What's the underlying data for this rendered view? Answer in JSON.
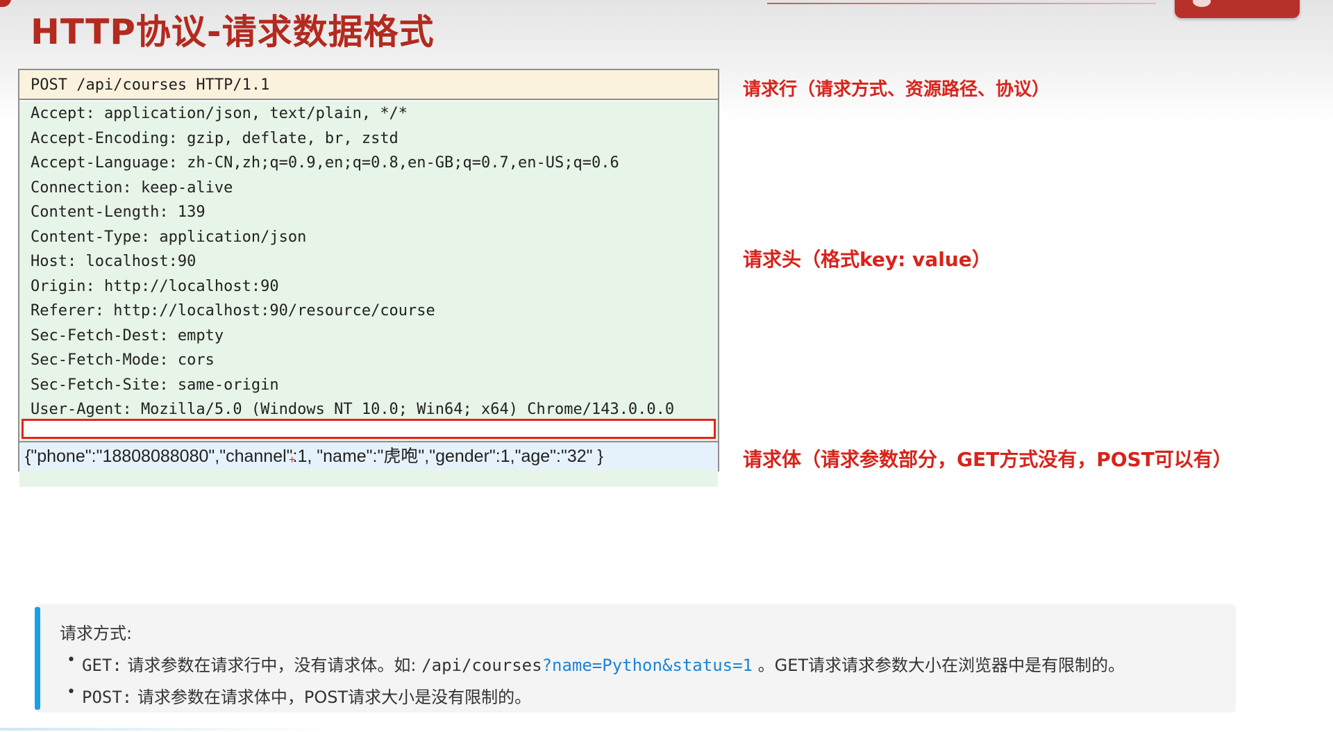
{
  "title": "HTTP协议-请求数据格式",
  "request": {
    "request_line": "POST /api/courses HTTP/1.1",
    "headers": [
      "Accept: application/json, text/plain, */*",
      "Accept-Encoding: gzip, deflate, br, zstd",
      "Accept-Language: zh-CN,zh;q=0.9,en;q=0.8,en-GB;q=0.7,en-US;q=0.6",
      "Connection: keep-alive",
      "Content-Length: 139",
      "Content-Type: application/json",
      "Host: localhost:90",
      "Origin: http://localhost:90",
      "Referer: http://localhost:90/resource/course",
      "Sec-Fetch-Dest: empty",
      "Sec-Fetch-Mode: cors",
      "Sec-Fetch-Site: same-origin",
      "User-Agent: Mozilla/5.0 (Windows NT 10.0; Win64; x64) Chrome/143.0.0.0"
    ],
    "body": "{\"phone\":\"18808088080\",\"channel\":1, \"name\":\"虎咆\",\"gender\":1,\"age\":\"32\" }"
  },
  "annotations": {
    "request_line": "请求行（请求方式、资源路径、协议）",
    "headers": "请求头（格式key: value）",
    "body": "请求体（请求参数部分，GET方式没有，POST可以有）"
  },
  "note": {
    "heading": "请求方式:",
    "get": {
      "method": "GET:",
      "text_before": "请求参数在请求行中，没有请求体。如:",
      "path": "/api/courses",
      "query": "?name=Python&status=1",
      "text_after": "。GET请求请求参数大小在浏览器中是有限制的。"
    },
    "post": {
      "method": "POST:",
      "text": "请求参数在请求体中，POST请求大小是没有限制的。"
    }
  },
  "colors": {
    "title": "#b32a1f",
    "annotation": "#d8231b",
    "request_line_bg": "#fbf2dd",
    "headers_bg": "#e7f4e8",
    "body_bg": "#e6f2fb",
    "empty_line_border": "#e0261b",
    "note_accent": "#1aa0e6",
    "query_link": "#1a84d8"
  }
}
